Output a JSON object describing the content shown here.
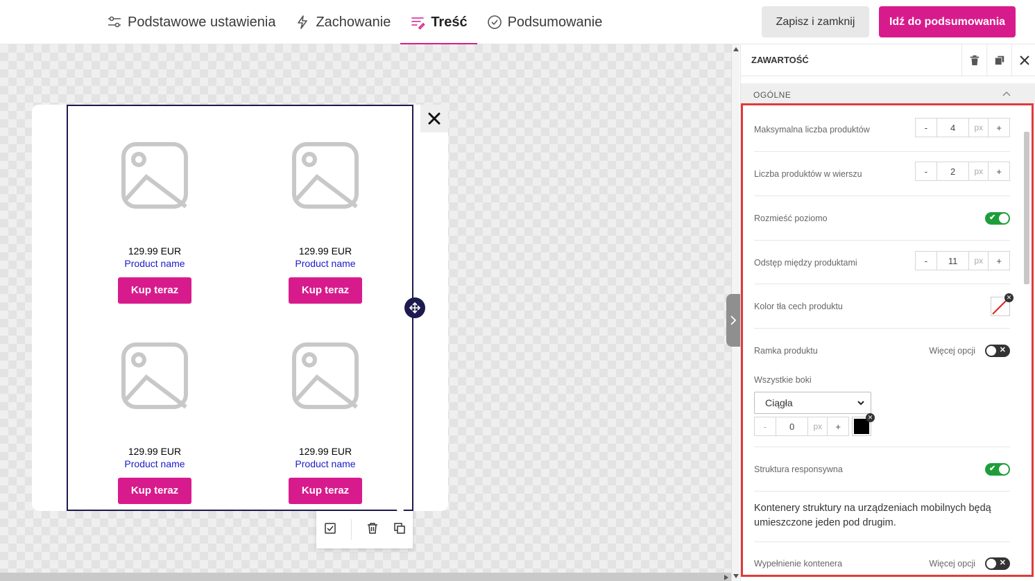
{
  "nav": {
    "tabs": [
      {
        "label": "Podstawowe ustawienia",
        "icon": "sliders-icon"
      },
      {
        "label": "Zachowanie",
        "icon": "lightning-icon"
      },
      {
        "label": "Treść",
        "icon": "content-icon"
      },
      {
        "label": "Podsumowanie",
        "icon": "check-circle-icon"
      }
    ],
    "active_tab": "Treść",
    "save_label": "Zapisz i zamknij",
    "primary_label": "Idź do podsumowania",
    "accent_color": "#d81b8c"
  },
  "canvas": {
    "products": [
      {
        "price": "129.99 EUR",
        "name": "Product name",
        "button": "Kup teraz"
      },
      {
        "price": "129.99 EUR",
        "name": "Product name",
        "button": "Kup teraz"
      },
      {
        "price": "129.99 EUR",
        "name": "Product name",
        "button": "Kup teraz"
      },
      {
        "price": "129.99 EUR",
        "name": "Product name",
        "button": "Kup teraz"
      }
    ]
  },
  "panel": {
    "title": "ZAWARTOŚĆ",
    "section": "OGÓLNE",
    "max_products": {
      "label": "Maksymalna liczba produktów",
      "value": "4",
      "unit": "px"
    },
    "per_row": {
      "label": "Liczba produktów w wierszu",
      "value": "2",
      "unit": "px"
    },
    "horizontal": {
      "label": "Rozmieść poziomo",
      "on": true
    },
    "spacing": {
      "label": "Odstęp między produktami",
      "value": "11",
      "unit": "px"
    },
    "bg_color": {
      "label": "Kolor tła cech produktu"
    },
    "border": {
      "label": "Ramka produktu",
      "more": "Więcej opcji",
      "on": false
    },
    "all_sides": {
      "label": "Wszystkie boki",
      "style": "Ciągła",
      "value": "0",
      "unit": "px",
      "color": "#000000"
    },
    "responsive": {
      "label": "Struktura responsywna",
      "on": true
    },
    "responsive_desc": "Kontenery struktury na urządzeniach mobilnych będą umieszczone jeden pod drugim.",
    "padding": {
      "label": "Wypełnienie kontenera",
      "more": "Więcej opcji",
      "on": false
    }
  }
}
